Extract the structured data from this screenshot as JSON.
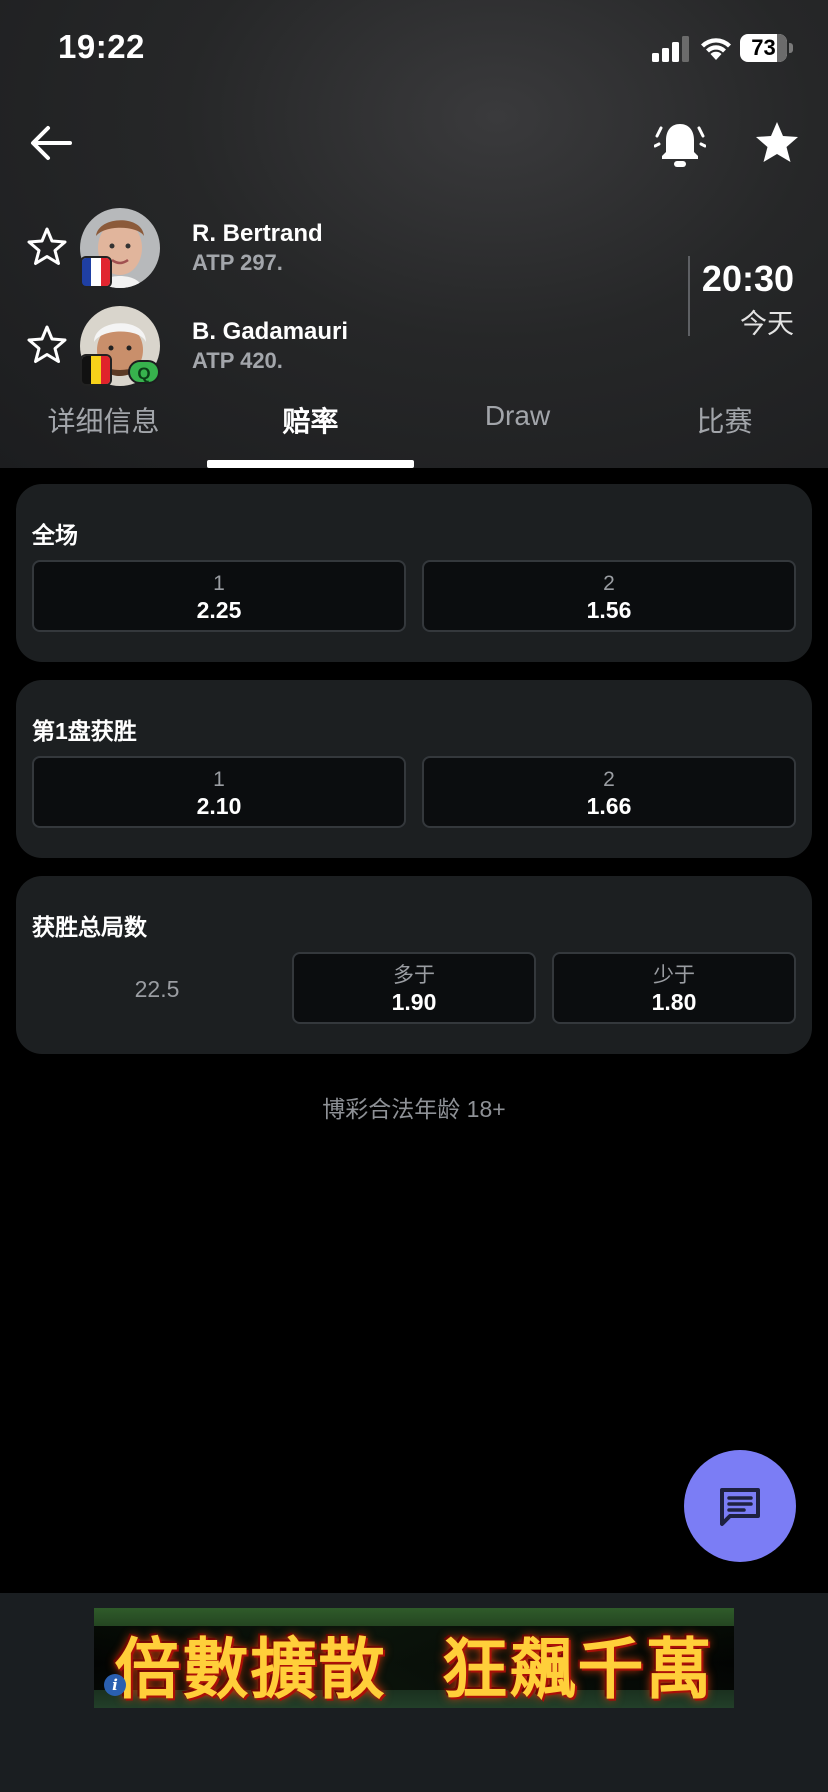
{
  "status_bar": {
    "time": "19:22",
    "battery": "73"
  },
  "header": {
    "back_icon": "arrow-left-icon",
    "alarm_icon": "alarm-bell-icon",
    "favorite_icon": "star-filled-icon"
  },
  "players": [
    {
      "name": "R. Bertrand",
      "rank": "ATP 297.",
      "flag": "France",
      "qualifier": ""
    },
    {
      "name": "B. Gadamauri",
      "rank": "ATP 420.",
      "flag": "Belgium",
      "qualifier": "Q"
    }
  ],
  "match": {
    "time": "20:30",
    "day": "今天"
  },
  "tabs": [
    {
      "label": "详细信息",
      "active": false
    },
    {
      "label": "赔率",
      "active": true
    },
    {
      "label": "Draw",
      "active": false
    },
    {
      "label": "比赛",
      "active": false
    }
  ],
  "markets": [
    {
      "title": "全场",
      "options": [
        {
          "label": "1",
          "odds": "2.25"
        },
        {
          "label": "2",
          "odds": "1.56"
        }
      ]
    },
    {
      "title": "第1盘获胜",
      "options": [
        {
          "label": "1",
          "odds": "2.10"
        },
        {
          "label": "2",
          "odds": "1.66"
        }
      ]
    },
    {
      "title": "获胜总局数",
      "line": "22.5",
      "options": [
        {
          "label": "多于",
          "odds": "1.90"
        },
        {
          "label": "少于",
          "odds": "1.80"
        }
      ]
    }
  ],
  "footer_note": "博彩合法年龄 18+",
  "chat_button": {
    "icon": "chat-message-icon"
  },
  "ad": {
    "text": "倍數擴散 狂飆千萬",
    "info_icon": "i"
  },
  "colors": {
    "accent": "#7b7df5",
    "card_bg": "#1c1f21",
    "qualifier_badge": "#37b24d"
  }
}
